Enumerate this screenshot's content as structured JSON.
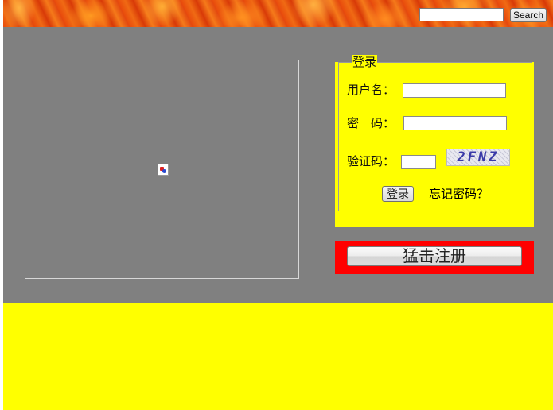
{
  "header": {
    "search_placeholder": "",
    "search_label": "Search"
  },
  "login": {
    "legend": "登录",
    "username_label": "用户名：",
    "password_label": "密　码：",
    "captcha_label": "验证码：",
    "captcha_text": "2FNZ",
    "login_button": "登录",
    "forgot_link": "忘记密码？"
  },
  "register": {
    "button_label": "猛击注册"
  },
  "colors": {
    "main_bg": "#808080",
    "panel_yellow": "#ffff00",
    "register_red": "#ff0000"
  }
}
